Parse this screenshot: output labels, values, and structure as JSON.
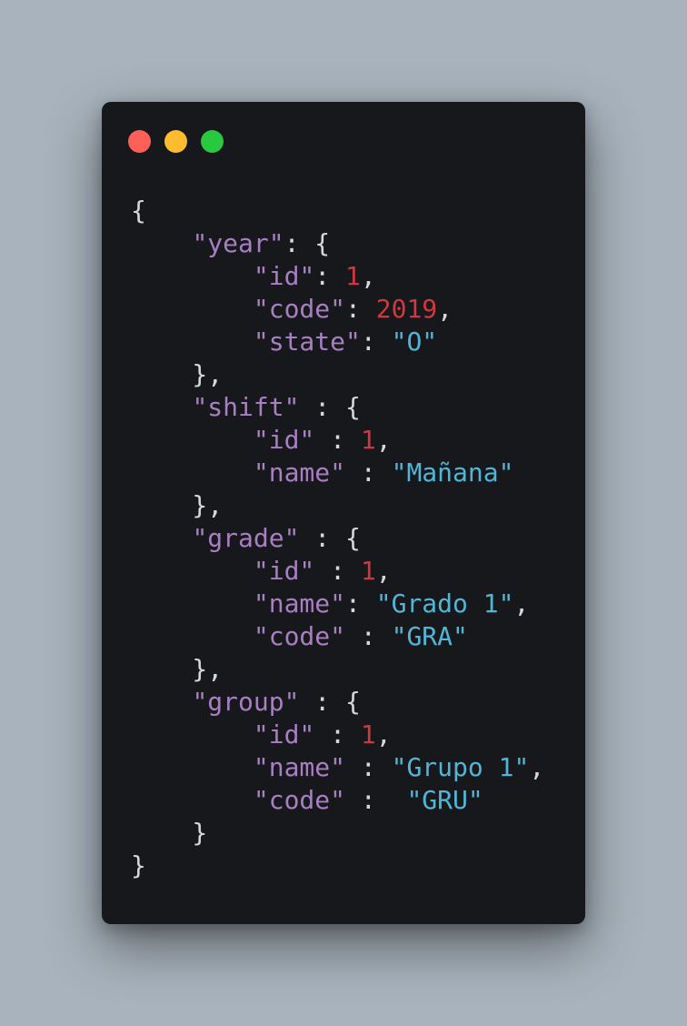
{
  "window": {
    "controls": [
      {
        "name": "close",
        "color": "#fe5f57"
      },
      {
        "name": "minimize",
        "color": "#febc2e"
      },
      {
        "name": "zoom",
        "color": "#28c840"
      }
    ]
  },
  "colors": {
    "background": "#a8b3bd",
    "editor": "#17181b",
    "key": "#a87fc2",
    "number": "#d0373f",
    "string": "#53b5d6",
    "punctuation": "#d6d8db"
  },
  "code_lines": [
    [
      {
        "t": "p",
        "v": "{"
      }
    ],
    [
      {
        "t": "p",
        "v": "    "
      },
      {
        "t": "k",
        "v": "\"year\""
      },
      {
        "t": "p",
        "v": ": {"
      }
    ],
    [
      {
        "t": "p",
        "v": "        "
      },
      {
        "t": "k",
        "v": "\"id\""
      },
      {
        "t": "p",
        "v": ": "
      },
      {
        "t": "n",
        "v": "1"
      },
      {
        "t": "p",
        "v": ","
      }
    ],
    [
      {
        "t": "p",
        "v": "        "
      },
      {
        "t": "k",
        "v": "\"code\""
      },
      {
        "t": "p",
        "v": ": "
      },
      {
        "t": "n",
        "v": "2019"
      },
      {
        "t": "p",
        "v": ","
      }
    ],
    [
      {
        "t": "p",
        "v": "        "
      },
      {
        "t": "k",
        "v": "\"state\""
      },
      {
        "t": "p",
        "v": ": "
      },
      {
        "t": "s",
        "v": "\"O\""
      }
    ],
    [
      {
        "t": "p",
        "v": "    },"
      }
    ],
    [
      {
        "t": "p",
        "v": "    "
      },
      {
        "t": "k",
        "v": "\"shift\""
      },
      {
        "t": "p",
        "v": " : {"
      }
    ],
    [
      {
        "t": "p",
        "v": "        "
      },
      {
        "t": "k",
        "v": "\"id\""
      },
      {
        "t": "p",
        "v": " : "
      },
      {
        "t": "n",
        "v": "1"
      },
      {
        "t": "p",
        "v": ","
      }
    ],
    [
      {
        "t": "p",
        "v": "        "
      },
      {
        "t": "k",
        "v": "\"name\""
      },
      {
        "t": "p",
        "v": " : "
      },
      {
        "t": "s",
        "v": "\"Mañana\""
      }
    ],
    [
      {
        "t": "p",
        "v": "    },"
      }
    ],
    [
      {
        "t": "p",
        "v": "    "
      },
      {
        "t": "k",
        "v": "\"grade\""
      },
      {
        "t": "p",
        "v": " : {"
      }
    ],
    [
      {
        "t": "p",
        "v": "        "
      },
      {
        "t": "k",
        "v": "\"id\""
      },
      {
        "t": "p",
        "v": " : "
      },
      {
        "t": "n",
        "v": "1"
      },
      {
        "t": "p",
        "v": ","
      }
    ],
    [
      {
        "t": "p",
        "v": "        "
      },
      {
        "t": "k",
        "v": "\"name\""
      },
      {
        "t": "p",
        "v": ": "
      },
      {
        "t": "s",
        "v": "\"Grado 1\""
      },
      {
        "t": "p",
        "v": ","
      }
    ],
    [
      {
        "t": "p",
        "v": "        "
      },
      {
        "t": "k",
        "v": "\"code\""
      },
      {
        "t": "p",
        "v": " : "
      },
      {
        "t": "s",
        "v": "\"GRA\""
      }
    ],
    [
      {
        "t": "p",
        "v": "    },"
      }
    ],
    [
      {
        "t": "p",
        "v": "    "
      },
      {
        "t": "k",
        "v": "\"group\""
      },
      {
        "t": "p",
        "v": " : {"
      }
    ],
    [
      {
        "t": "p",
        "v": "        "
      },
      {
        "t": "k",
        "v": "\"id\""
      },
      {
        "t": "p",
        "v": " : "
      },
      {
        "t": "n",
        "v": "1"
      },
      {
        "t": "p",
        "v": ","
      }
    ],
    [
      {
        "t": "p",
        "v": "        "
      },
      {
        "t": "k",
        "v": "\"name\""
      },
      {
        "t": "p",
        "v": " : "
      },
      {
        "t": "s",
        "v": "\"Grupo 1\""
      },
      {
        "t": "p",
        "v": ","
      }
    ],
    [
      {
        "t": "p",
        "v": "        "
      },
      {
        "t": "k",
        "v": "\"code\""
      },
      {
        "t": "p",
        "v": " :  "
      },
      {
        "t": "s",
        "v": "\"GRU\""
      }
    ],
    [
      {
        "t": "p",
        "v": "    }"
      }
    ],
    [
      {
        "t": "p",
        "v": "}"
      }
    ]
  ]
}
